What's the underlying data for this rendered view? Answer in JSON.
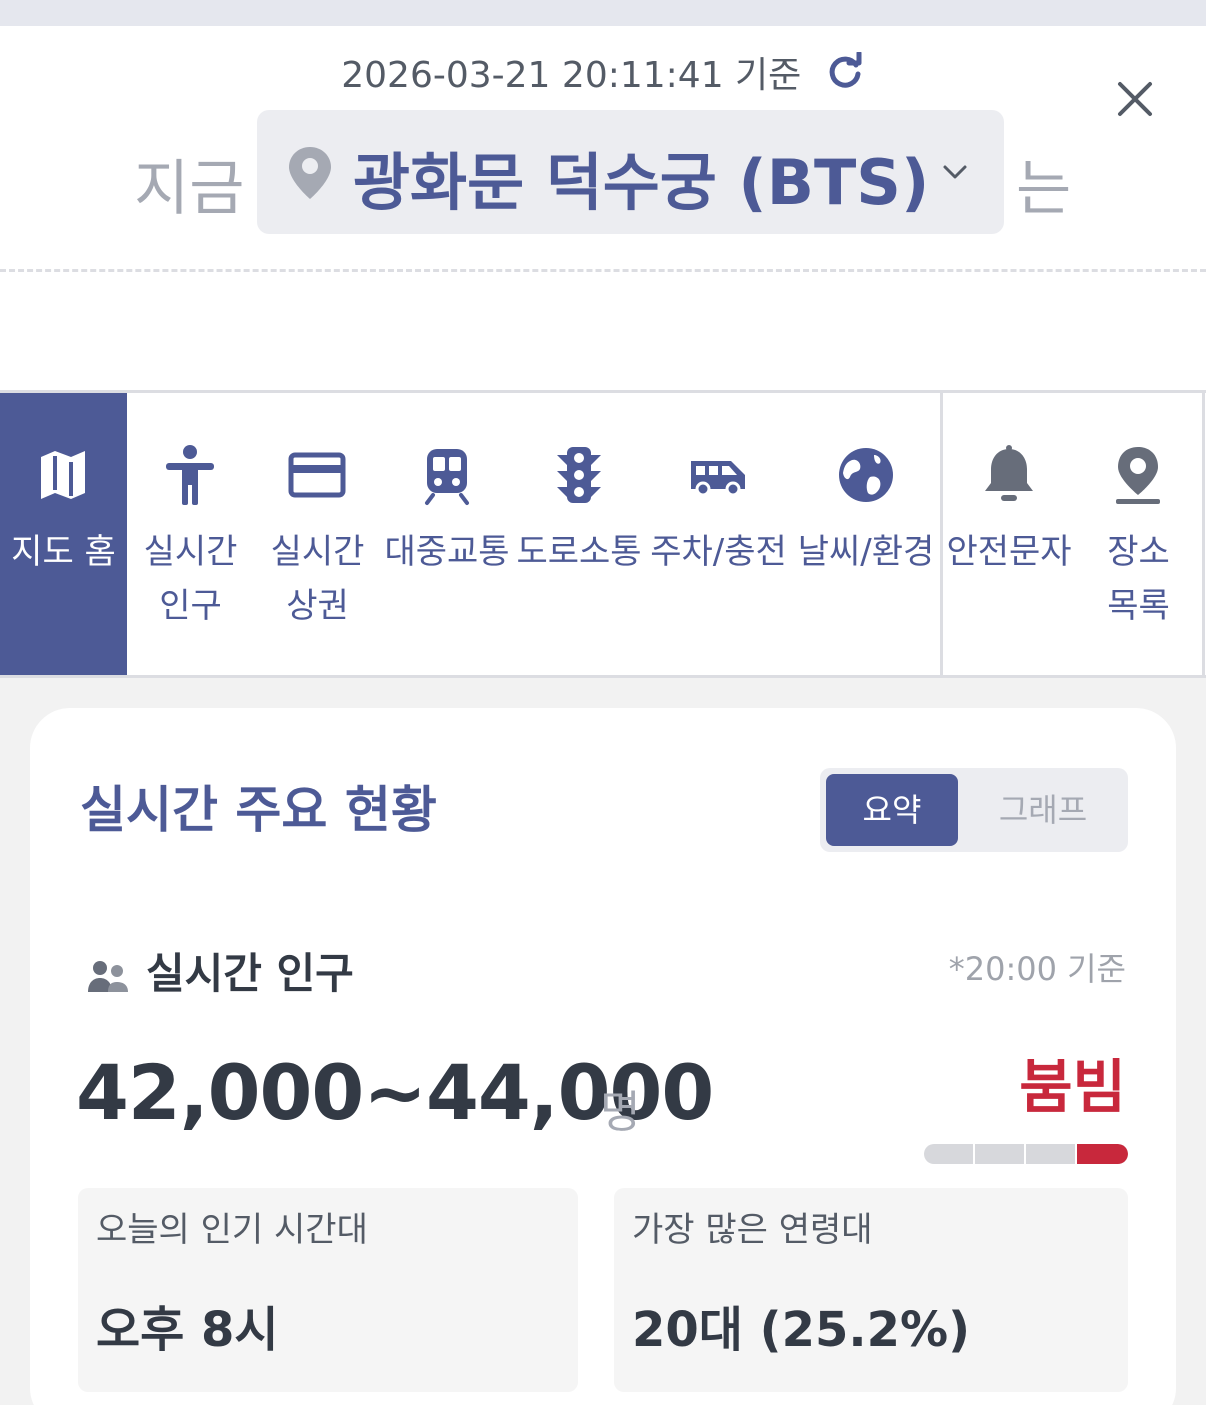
{
  "header": {
    "timestamp": "2026-03-21 20:11:41 기준",
    "now_prefix": "지금",
    "now_suffix": "는",
    "location_name": "광화문 덕수궁 (BTS)"
  },
  "tabs": [
    {
      "label": "지도 홈",
      "icon": "map-icon",
      "active": true
    },
    {
      "label": "실시간\n인구",
      "icon": "person-icon",
      "active": false
    },
    {
      "label": "실시간\n상권",
      "icon": "credit-card-icon",
      "active": false
    },
    {
      "label": "대중교통",
      "icon": "train-icon",
      "active": false
    },
    {
      "label": "도로소통",
      "icon": "traffic-light-icon",
      "active": false
    },
    {
      "label": "주차/충전",
      "icon": "van-icon",
      "active": false
    },
    {
      "label": "날씨/환경",
      "icon": "globe-icon",
      "active": false
    },
    {
      "label": "안전문자",
      "icon": "bell-icon",
      "active": false
    },
    {
      "label": "장소\n목록",
      "icon": "location-pin-icon",
      "active": false
    }
  ],
  "summary": {
    "title": "실시간 주요 현황",
    "toggle_on": "요약",
    "toggle_off": "그래프"
  },
  "population": {
    "section_title": "실시간 인구",
    "basis": "*20:00 기준",
    "value": "42,000~44,000",
    "unit": "명",
    "congestion": "붐빔",
    "congestion_level": 4,
    "congestion_max": 4,
    "popular_time_label": "오늘의 인기 시간대",
    "popular_time_value": "오후 8시",
    "top_age_label": "가장 많은 연령대",
    "top_age_value": "20대 (25.2%)"
  },
  "colors": {
    "brand": "#4d5a96",
    "crowded": "#c8283c",
    "muted": "#a5a9b3"
  }
}
